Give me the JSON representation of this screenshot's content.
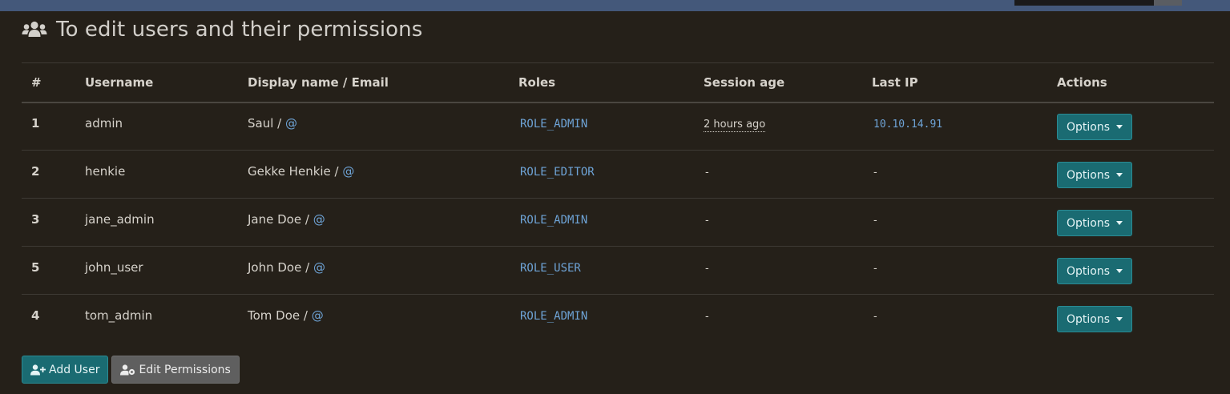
{
  "page": {
    "title": "To edit users and their permissions",
    "title_icon": "users-icon"
  },
  "table": {
    "headers": {
      "num": "#",
      "username": "Username",
      "display": "Display name / Email",
      "roles": "Roles",
      "session": "Session age",
      "ip": "Last IP",
      "actions": "Actions"
    },
    "rows": [
      {
        "num": "1",
        "username": "admin",
        "display_name": "Saul /",
        "email": "@",
        "role": "ROLE_ADMIN",
        "session_age": "2 hours ago",
        "last_ip": "10.10.14.91",
        "action": "Options"
      },
      {
        "num": "2",
        "username": "henkie",
        "display_name": "Gekke Henkie /",
        "email": "@",
        "role": "ROLE_EDITOR",
        "session_age": "-",
        "last_ip": "-",
        "action": "Options"
      },
      {
        "num": "3",
        "username": "jane_admin",
        "display_name": "Jane Doe /",
        "email": "@",
        "role": "ROLE_ADMIN",
        "session_age": "-",
        "last_ip": "-",
        "action": "Options"
      },
      {
        "num": "5",
        "username": "john_user",
        "display_name": "John Doe /",
        "email": "@",
        "role": "ROLE_USER",
        "session_age": "-",
        "last_ip": "-",
        "action": "Options"
      },
      {
        "num": "4",
        "username": "tom_admin",
        "display_name": "Tom Doe /",
        "email": "@",
        "role": "ROLE_ADMIN",
        "session_age": "-",
        "last_ip": "-",
        "action": "Options"
      }
    ]
  },
  "buttons": {
    "add_user": "Add User",
    "edit_permissions": "Edit Permissions"
  },
  "colors": {
    "background": "#252019",
    "topbar": "#44587a",
    "primary_button": "#1a6b72",
    "secondary_button": "#5f5f5f",
    "code_text": "#6ea3d6"
  }
}
